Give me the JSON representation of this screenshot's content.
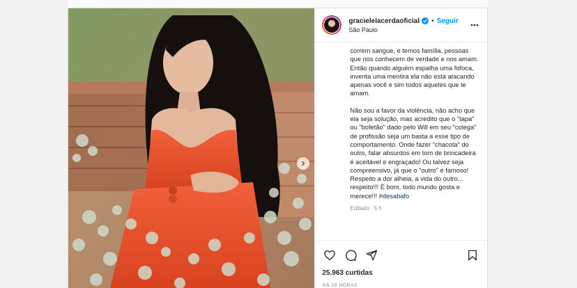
{
  "header": {
    "username": "gracielelacerdaoficial",
    "separator": "•",
    "follow_label": "Seguir",
    "location": "São Paulo"
  },
  "caption": {
    "paragraph1": "correm sangue, e temos família, pessoas que nos conhecem de verdade e nos amam. Então quando alguém espalha uma fofoca, inventa uma mentira ela não está atacando apenas você e sim todos aqueles que te amam.",
    "paragraph2": "Não sou a favor da violência, não acho que ela seja solução, mas acredito que o \"tapa\" ou \"bofetão\" dado pelo Will em seu \"colega\" de profissão seja um basta a esse tipo de comportamento. Onde fazer \"chacota\" do outro, falar absurdos em tom de brincadeira é aceitável e engraçado! Ou talvez seja compreensivo, já que o \"outro\" é famoso!",
    "paragraph3": "Respeito a dor alheia, a vida do outro... respeito!!! É bom, todo mundo gosta e merece!!!",
    "hashtag": "#desabafo",
    "edited": "Editado · 5 h"
  },
  "stats": {
    "likes": "25.963 curtidas",
    "timestamp": "HÁ 19 HORAS"
  },
  "icons": {
    "like": "heart-icon",
    "comment": "comment-icon",
    "share": "share-icon",
    "save": "bookmark-icon",
    "verified": "verified-badge-icon",
    "more": "more-options-icon",
    "next": "chevron-right-icon"
  },
  "colors": {
    "accent": "#0095f6",
    "verified": "#0095f6",
    "hashtag": "#00376b",
    "dress": "#e8502a"
  }
}
